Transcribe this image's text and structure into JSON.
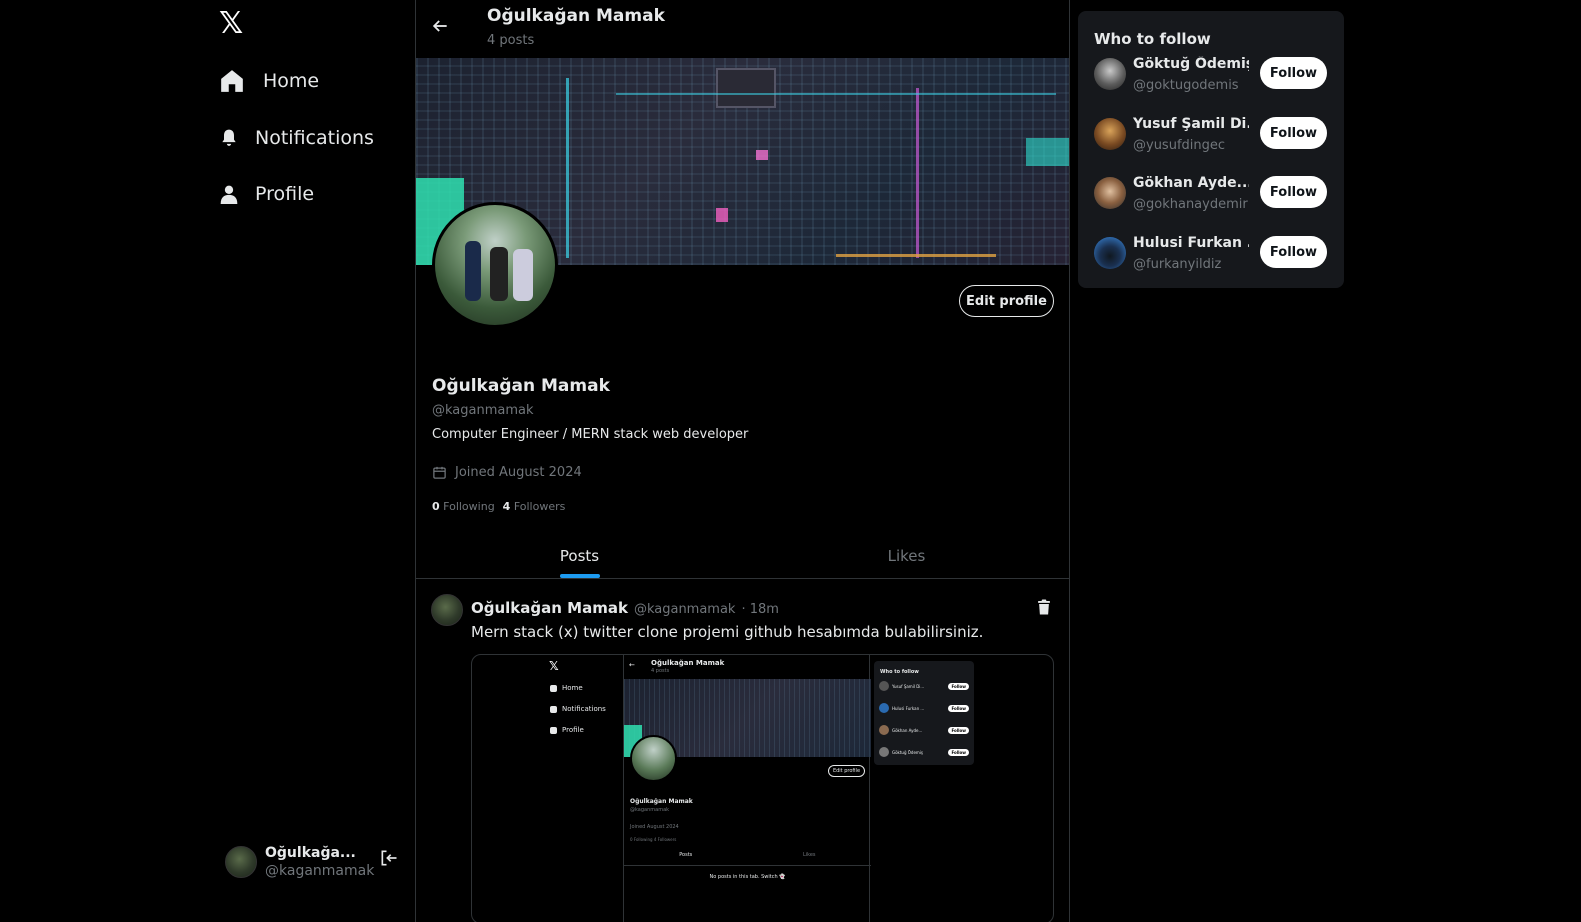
{
  "sidebar": {
    "logo": "𝕏",
    "nav": [
      {
        "label": "Home",
        "icon": "home-icon"
      },
      {
        "label": "Notifications",
        "icon": "bell-icon"
      },
      {
        "label": "Profile",
        "icon": "user-icon"
      }
    ],
    "account": {
      "name": "Oğulkağa...",
      "handle": "@kaganmamak"
    }
  },
  "header": {
    "title": "Oğulkağan Mamak",
    "subtitle": "4 posts"
  },
  "profile": {
    "name": "Oğulkağan Mamak",
    "handle": "@kaganmamak",
    "bio": "Computer Engineer / MERN stack web developer",
    "joined": "Joined August 2024",
    "following_count": "0",
    "following_label": "Following",
    "followers_count": "4",
    "followers_label": "Followers",
    "edit_label": "Edit profile"
  },
  "tabs": [
    {
      "label": "Posts",
      "active": true
    },
    {
      "label": "Likes",
      "active": false
    }
  ],
  "post": {
    "name": "Oğulkağan Mamak",
    "handle": "@kaganmamak",
    "time": "· 18m",
    "text": "Mern stack (x) twitter clone projemi github hesabımda bulabilirsiniz."
  },
  "mini": {
    "logo": "𝕏",
    "nav": [
      "Home",
      "Notifications",
      "Profile"
    ],
    "back": "←",
    "title": "Oğulkağan Mamak",
    "subtitle": "4 posts",
    "edit": "Edit profile",
    "name": "Oğulkağan Mamak",
    "handle": "@kaganmamak",
    "joined": "Joined August 2024",
    "follow": "0 Following  4 Followers",
    "tabs": [
      "Posts",
      "Likes"
    ],
    "empty": "No posts in this tab. Switch 👻",
    "wtf_title": "Who to follow",
    "wtf": [
      {
        "name": "Yusuf Şamil Di...",
        "handle": "@yusufdingec"
      },
      {
        "name": "Hulusi Furkan ...",
        "handle": "@furkanyildiz"
      },
      {
        "name": "Gökhan Ayde...",
        "handle": "@gokhanaydemir"
      },
      {
        "name": "Göktuğ Ödemiş",
        "handle": "@goktugodemis"
      }
    ],
    "follow_label": "Follow"
  },
  "who_to_follow": {
    "title": "Who to follow",
    "follow_label": "Follow",
    "users": [
      {
        "name": "Göktuğ Ödemiş",
        "handle": "@goktugodemis"
      },
      {
        "name": "Yusuf Şamil Di...",
        "handle": "@yusufdingec"
      },
      {
        "name": "Gökhan Ayde...",
        "handle": "@gokhanaydemir"
      },
      {
        "name": "Hulusi Furkan ...",
        "handle": "@furkanyildiz"
      }
    ]
  },
  "colors": {
    "accent": "#1d9bf0",
    "background": "#000000",
    "panel": "#16181c",
    "muted": "#71767b",
    "text": "#e7e9ea"
  }
}
